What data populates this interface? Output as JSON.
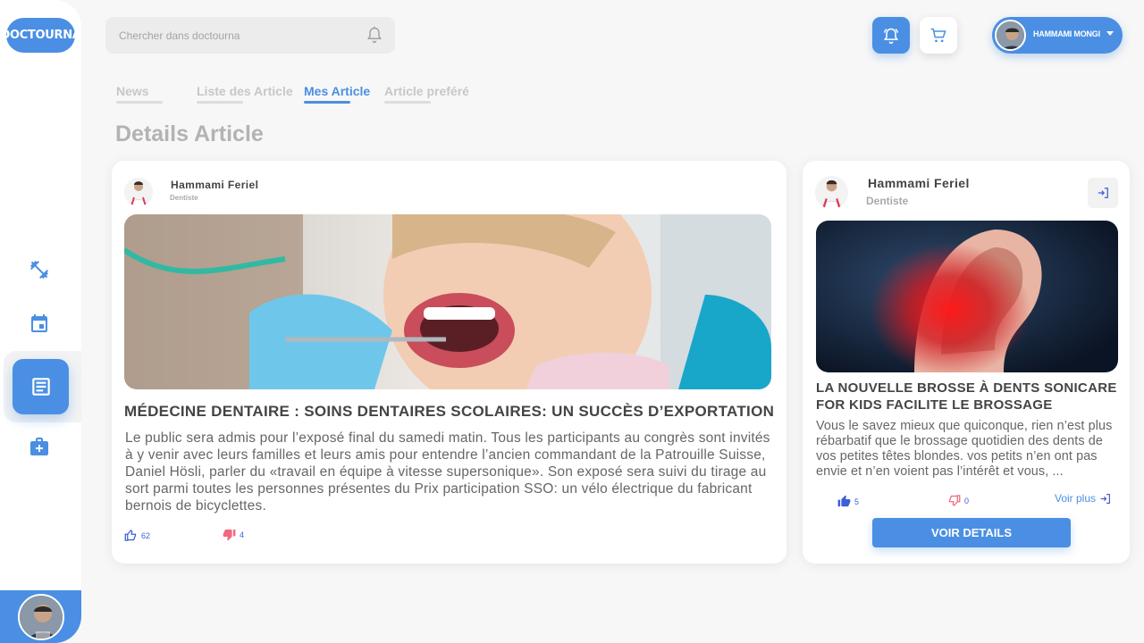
{
  "app": {
    "logo_text": "DOCTOURNA"
  },
  "search": {
    "placeholder": "Chercher dans doctourna"
  },
  "user": {
    "name": "HAMMAMI MONGI"
  },
  "tabs": [
    {
      "label": "News",
      "active": false
    },
    {
      "label": "Liste des Article",
      "active": false
    },
    {
      "label": "Mes Article",
      "active": true
    },
    {
      "label": "Article preféré",
      "active": false
    }
  ],
  "page_title": "Details Article",
  "sidebar": {
    "items": [
      {
        "icon": "dumbbell-icon"
      },
      {
        "icon": "calendar-icon"
      },
      {
        "icon": "article-icon",
        "active": true
      },
      {
        "icon": "medical-kit-icon"
      }
    ]
  },
  "main_article": {
    "author": "Hammami Feriel",
    "role": "Dentiste",
    "title": "Médecine dentaire : soins dentaires scolaires: un succès d’exportation",
    "body": "Le public sera admis pour l’exposé final  du samedi matin. Tous les participants au congrès sont invités à y venir avec leurs familles et leurs amis pour entendre l’ancien commandant de la Patrouille Suisse, Daniel Hösli, parler du «travail en équipe à vitesse supersonique». Son exposé sera suivi du tirage au sort parmi toutes les personnes présentes du Prix participation SSO: un vélo électrique du fabricant bernois de bicyclettes.",
    "likes": "62",
    "dislikes": "4"
  },
  "side_article": {
    "author": "Hammami Feriel",
    "role": "Dentiste",
    "title": "La nouvelle brosse à dents Sonicare for Kids facilite le brossage",
    "body": "Vous le savez mieux que quiconque, rien n’est plus rébarbatif que le brossage quotidien des dents de vos petites têtes blondes. vos petits n’en ont pas envie et n’en voient pas l’intérêt et vous, ...",
    "likes": "5",
    "dislikes": "0",
    "more_label": "Voir plus",
    "details_button": "VOIR DETAILS"
  },
  "colors": {
    "accent": "#4a8fe3",
    "like": "#3b5fd9",
    "dislike": "#f06a7f"
  }
}
